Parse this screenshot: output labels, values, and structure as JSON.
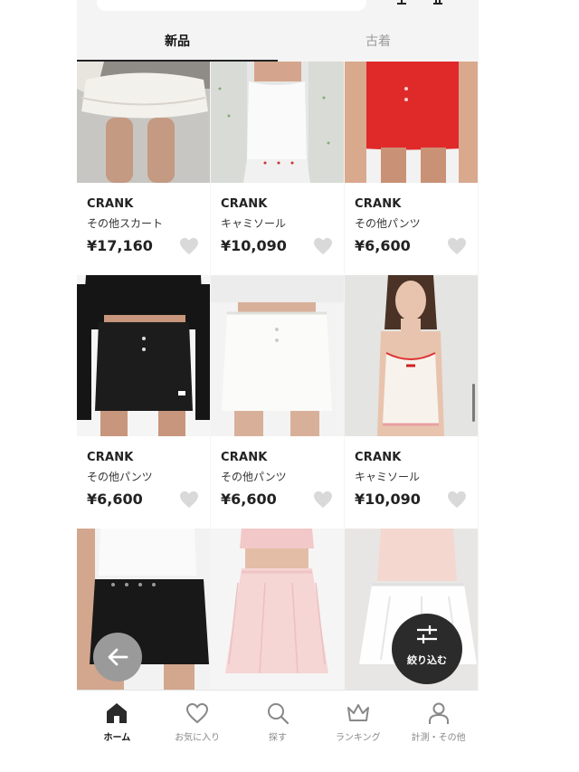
{
  "tabs": [
    {
      "label": "新品",
      "active": true
    },
    {
      "label": "古着",
      "active": false
    }
  ],
  "products": [
    {
      "brand": "CRANK",
      "category": "その他スカート",
      "price": "¥17,160"
    },
    {
      "brand": "CRANK",
      "category": "キャミソール",
      "price": "¥10,090"
    },
    {
      "brand": "CRANK",
      "category": "その他パンツ",
      "price": "¥6,600"
    },
    {
      "brand": "CRANK",
      "category": "その他パンツ",
      "price": "¥6,600"
    },
    {
      "brand": "CRANK",
      "category": "その他パンツ",
      "price": "¥6,600"
    },
    {
      "brand": "CRANK",
      "category": "キャミソール",
      "price": "¥10,090"
    }
  ],
  "bottom_nav": [
    {
      "label": "ホーム",
      "icon": "home-icon",
      "active": true
    },
    {
      "label": "お気に入り",
      "icon": "heart-icon",
      "active": false
    },
    {
      "label": "探す",
      "icon": "search-icon",
      "active": false
    },
    {
      "label": "ランキング",
      "icon": "crown-icon",
      "active": false
    },
    {
      "label": "計測・その他",
      "icon": "user-icon",
      "active": false
    }
  ],
  "filter_button": {
    "label": "絞り込む",
    "icon": "filter-sliders-icon"
  },
  "back_button": {
    "icon": "arrow-left-icon"
  },
  "colors": {
    "background": "#f4f4f4",
    "card": "#ffffff",
    "text": "#222222",
    "inactive_tab": "#9a9a9a",
    "fab_dark": "#2b2b2b",
    "fab_gray": "#9a9a9a",
    "heart": "#d9d9d9"
  }
}
